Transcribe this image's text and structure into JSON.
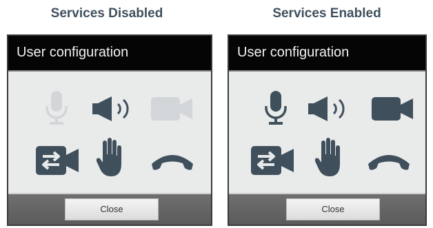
{
  "captions": {
    "disabled": "Services Disabled",
    "enabled": "Services Enabled"
  },
  "panels": [
    {
      "state": "disabled",
      "title": "User configuration",
      "close_label": "Close",
      "icons": {
        "microphone": {
          "name": "microphone-icon",
          "enabled": false
        },
        "speaker": {
          "name": "speaker-icon",
          "enabled": true
        },
        "video": {
          "name": "video-camera-icon",
          "enabled": false
        },
        "switch_camera": {
          "name": "switch-camera-icon",
          "enabled": true
        },
        "raise_hand": {
          "name": "raise-hand-icon",
          "enabled": true
        },
        "hang_up": {
          "name": "hang-up-icon",
          "enabled": true
        }
      }
    },
    {
      "state": "enabled",
      "title": "User configuration",
      "close_label": "Close",
      "icons": {
        "microphone": {
          "name": "microphone-icon",
          "enabled": true
        },
        "speaker": {
          "name": "speaker-icon",
          "enabled": true
        },
        "video": {
          "name": "video-camera-icon",
          "enabled": true
        },
        "switch_camera": {
          "name": "switch-camera-icon",
          "enabled": true
        },
        "raise_hand": {
          "name": "raise-hand-icon",
          "enabled": true
        },
        "hang_up": {
          "name": "hang-up-icon",
          "enabled": true
        }
      }
    }
  ],
  "colors": {
    "icon_active": "#3f4f5c",
    "icon_disabled": "#d2d6d9",
    "caption": "#3f4f5c",
    "header_bg": "#050505",
    "panel_bg": "#e9eaea"
  }
}
